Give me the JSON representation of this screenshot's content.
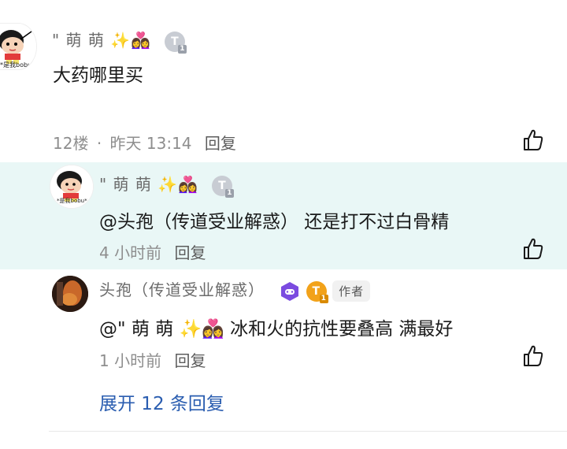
{
  "comment": {
    "username": "\" 萌 萌 ✨👩‍❤️‍👩",
    "level": "T",
    "text": "大药哪里买",
    "floor": "12楼",
    "separator": "·",
    "time": "昨天 13:14",
    "reply_label": "回复",
    "avatar_caption": "*是我bobu*"
  },
  "replies": [
    {
      "username": "\" 萌 萌 ✨👩‍❤️‍👩",
      "level": "T",
      "text": "@头孢（传道受业解惑） 还是打不过白骨精",
      "time": "4 小时前",
      "reply_label": "回复",
      "avatar_caption": "*是我bobu*",
      "highlighted": true
    },
    {
      "username": "头孢（传道受业解惑）",
      "level": "T",
      "author_tag": "作者",
      "text": "@\" 萌 萌 ✨👩‍❤️‍👩 冰和火的抗性要叠高 满最好",
      "time": "1 小时前",
      "reply_label": "回复"
    }
  ],
  "expand_label": "展开 12 条回复",
  "colors": {
    "highlight_bg": "#e9f7f6",
    "link_blue": "#2a5db0",
    "gold_badge": "#f2a21a",
    "game_badge": "#7b4be0"
  },
  "icons": [
    "like-icon",
    "level-badge-icon",
    "game-controller-icon"
  ]
}
